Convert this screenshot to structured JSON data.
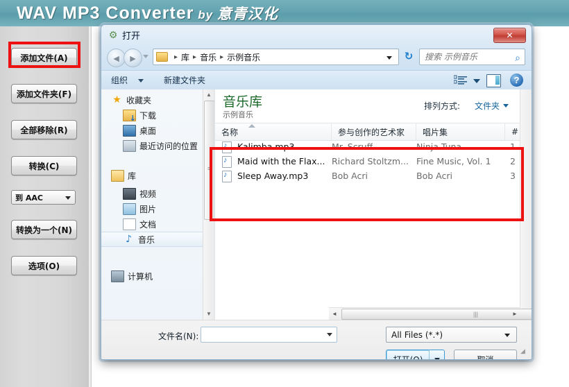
{
  "app": {
    "title_main": "WAV MP3 Converter",
    "title_by": " by ",
    "title_zh": "意青汉化",
    "banner_color": "#63a3b0"
  },
  "toolpanel": {
    "buttons": [
      {
        "label": "添加文件(A)",
        "name": "add-files-button",
        "highlighted": true
      },
      {
        "label": "添加文件夹(F)",
        "name": "add-folder-button"
      },
      {
        "label": "全部移除(R)",
        "name": "remove-all-button"
      },
      {
        "label": "转换(C)",
        "name": "convert-button"
      },
      {
        "label": "转换为一个(N)",
        "name": "convert-to-one-button"
      },
      {
        "label": "选项(O)",
        "name": "options-button"
      }
    ],
    "format_select": "到  AAC"
  },
  "dialog": {
    "title": "打开",
    "close_label": "✕",
    "address": {
      "crumbs": [
        "库",
        "音乐",
        "示例音乐"
      ],
      "separator": "▸"
    },
    "search": {
      "placeholder": "搜索 示例音乐",
      "icon": "search-icon"
    },
    "commandbar": {
      "organize": "组织",
      "new_folder": "新建文件夹",
      "help": "?"
    },
    "navpane": {
      "items": [
        {
          "label": "收藏夹",
          "level": 0,
          "icon": "star-icon"
        },
        {
          "label": "下载",
          "level": 1,
          "icon": "downloads-icon"
        },
        {
          "label": "桌面",
          "level": 1,
          "icon": "desktop-icon"
        },
        {
          "label": "最近访问的位置",
          "level": 1,
          "icon": "recent-places-icon"
        },
        {
          "label": "库",
          "level": 0,
          "icon": "library-icon"
        },
        {
          "label": "视频",
          "level": 1,
          "icon": "video-icon"
        },
        {
          "label": "图片",
          "level": 1,
          "icon": "picture-icon"
        },
        {
          "label": "文档",
          "level": 1,
          "icon": "document-icon"
        },
        {
          "label": "音乐",
          "level": 1,
          "icon": "music-icon",
          "selected": true
        },
        {
          "label": "计算机",
          "level": 0,
          "icon": "computer-icon"
        }
      ]
    },
    "listpane": {
      "library_title": "音乐库",
      "library_sub": "示例音乐",
      "arrange_label": "排列方式:",
      "arrange_value": "文件夹",
      "columns": [
        "名称",
        "参与创作的艺术家",
        "唱片集",
        "#"
      ],
      "rows": [
        {
          "name": "Kalimba.mp3",
          "artist": "Mr. Scruff",
          "album": "Ninja Tuna",
          "num": "1"
        },
        {
          "name": "Maid with the Flax...",
          "artist": "Richard Stoltzm...",
          "album": "Fine Music, Vol. 1",
          "num": "2"
        },
        {
          "name": "Sleep Away.mp3",
          "artist": "Bob Acri",
          "album": "Bob Acri",
          "num": "3"
        }
      ]
    },
    "footer": {
      "filename_label": "文件名(N):",
      "filename_value": "",
      "filetype_value": "All Files (*.*)",
      "open_button": "打开(O)",
      "cancel_button": "取消"
    }
  },
  "highlights": {
    "accent_color": "#ee1111"
  }
}
